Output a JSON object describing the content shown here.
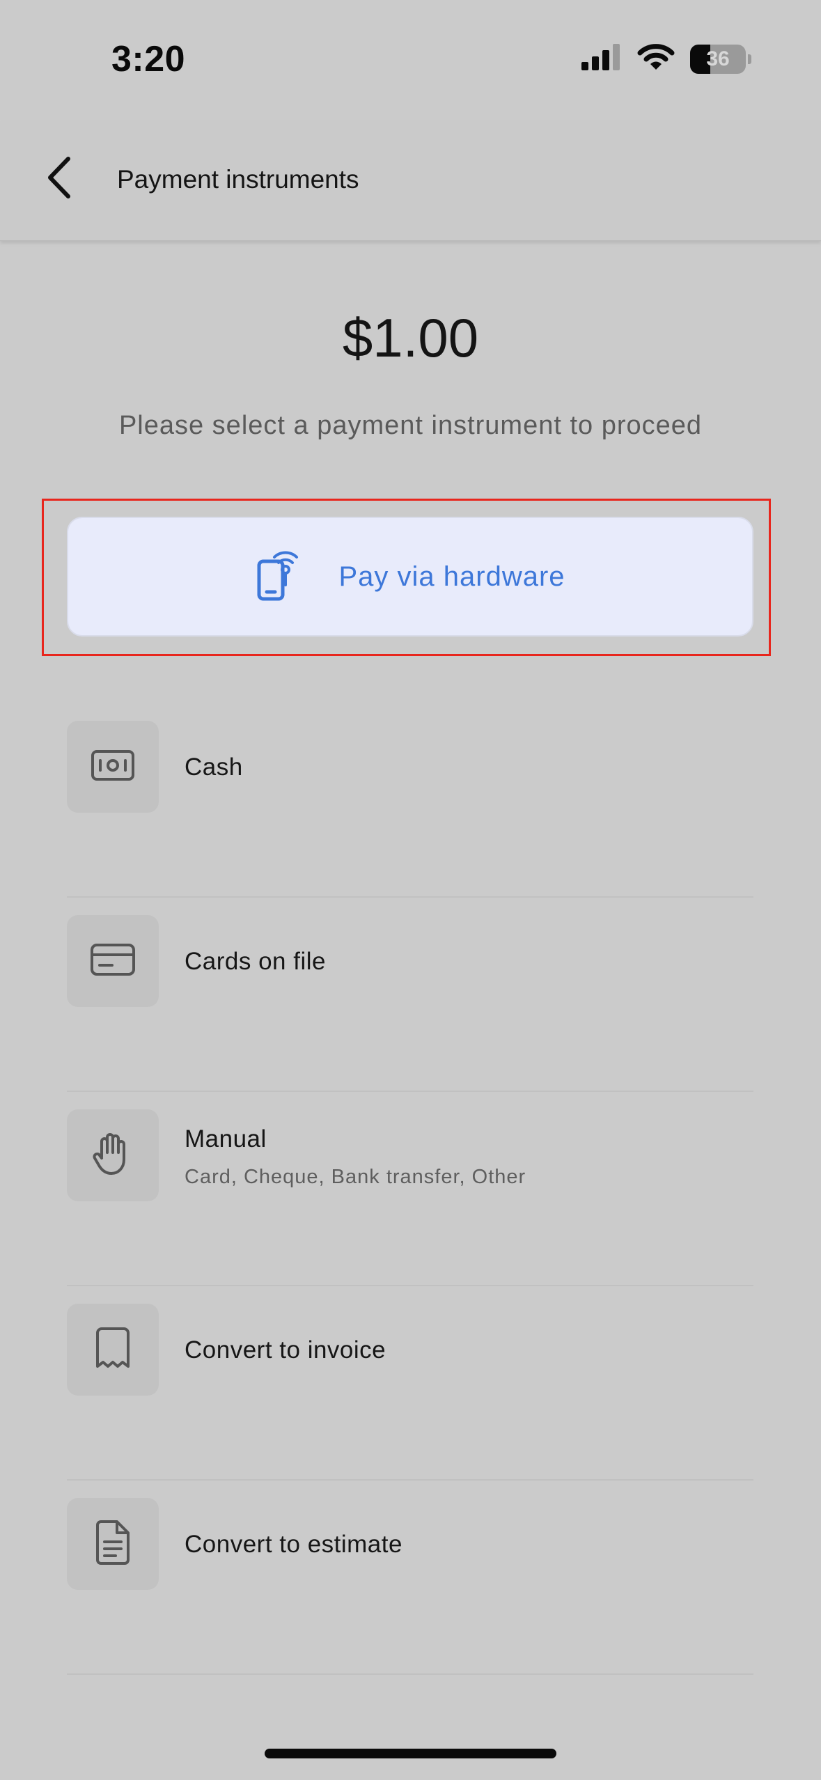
{
  "status_bar": {
    "time": "3:20",
    "battery_level": "36",
    "battery_fraction": 0.36
  },
  "header": {
    "title": "Payment instruments",
    "back_icon": "chevron-left-icon"
  },
  "amount": "$1.00",
  "instruction": "Please select a payment instrument to proceed",
  "hardware": {
    "label": "Pay via hardware",
    "icon": "phone-contactless-icon",
    "accent_color": "#3d77d9",
    "background_color": "#e8ebfb",
    "highlight_color": "#e8261d"
  },
  "options": [
    {
      "label": "Cash",
      "icon": "cash-icon"
    },
    {
      "label": "Cards on file",
      "icon": "credit-card-icon"
    },
    {
      "label": "Manual",
      "sublabel": "Card, Cheque, Bank transfer, Other",
      "icon": "hand-icon"
    },
    {
      "label": "Convert to invoice",
      "icon": "receipt-icon"
    },
    {
      "label": "Convert to estimate",
      "icon": "document-icon"
    }
  ]
}
